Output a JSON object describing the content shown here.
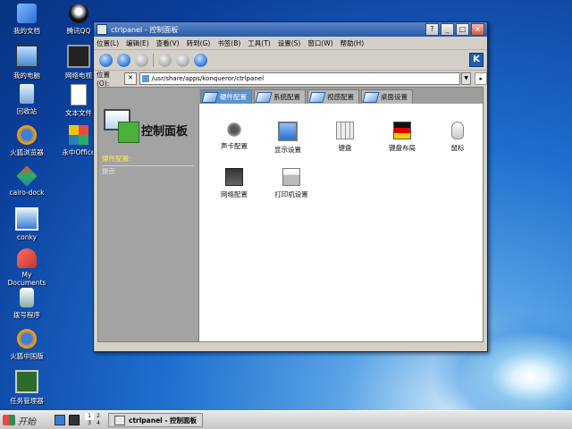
{
  "desktop": {
    "icons": [
      {
        "label": "我的文档"
      },
      {
        "label": "腾讯QQ"
      },
      {
        "label": "我的电脑"
      },
      {
        "label": "网络电视"
      },
      {
        "label": "回收站"
      },
      {
        "label": "文本文件"
      },
      {
        "label": "火狐浏览器"
      },
      {
        "label": "永中Office"
      },
      {
        "label": "cairo-dock"
      },
      {
        "label": "conky"
      },
      {
        "label": "My Documents"
      },
      {
        "label": "拨号程序"
      },
      {
        "label": "火狐中国版"
      },
      {
        "label": "任务管理器"
      }
    ]
  },
  "window": {
    "title": "ctrlpanel - 控制面板",
    "buttons": {
      "help": "?",
      "minimize": "_",
      "maximize": "□",
      "close": "×"
    },
    "menu": [
      "位置(L)",
      "编辑(E)",
      "查看(V)",
      "转到(G)",
      "书签(B)",
      "工具(T)",
      "设置(S)",
      "窗口(W)",
      "帮助(H)"
    ],
    "location": {
      "label": "位置(O):",
      "url": "/usr/share/apps/konqueror/ctrlpanel"
    },
    "kde_logo": "K"
  },
  "panel": {
    "title": "控制面板",
    "category": "硬件配置:",
    "hint": "提示"
  },
  "tabs": [
    "硬件配置",
    "系统配置",
    "视感配置",
    "桌面设置"
  ],
  "items": [
    {
      "label": "声卡配置"
    },
    {
      "label": "显示设置"
    },
    {
      "label": "键盘"
    },
    {
      "label": "键盘布局"
    },
    {
      "label": "鼠标"
    },
    {
      "label": "网络配置"
    },
    {
      "label": "打印机设置"
    }
  ],
  "taskbar": {
    "start": "开始",
    "pager": [
      "1",
      "2",
      "3",
      "4"
    ],
    "task": "ctrlpanel - 控制面板"
  },
  "colors": {
    "accent": "#2a5aa8",
    "active_tab": "#5b92d0",
    "category_text": "#ffeb3b"
  }
}
